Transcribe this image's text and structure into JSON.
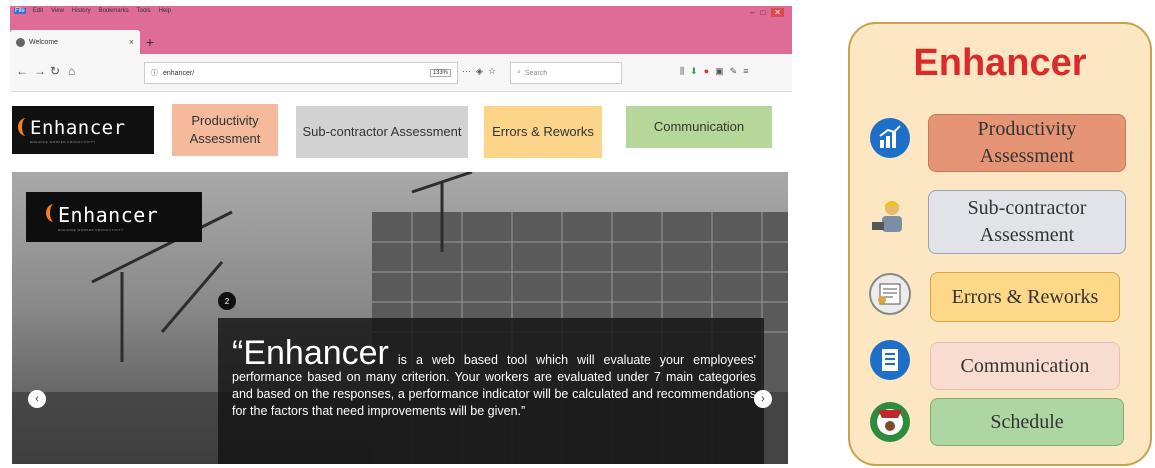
{
  "browser": {
    "menu": [
      "File",
      "Edit",
      "View",
      "History",
      "Bookmarks",
      "Tools",
      "Help"
    ],
    "window_controls": [
      "–",
      "□",
      "✕"
    ],
    "tab_title": "Welcome",
    "tab_close": "×",
    "new_tab": "+",
    "url": "enhancer/",
    "zoom": "133%",
    "search_placeholder": "Search"
  },
  "site": {
    "logo_text": "Enhancer",
    "logo_tagline": "ENHANCE WORKER PRODUCTIVITY",
    "nav": {
      "productivity": "Productivity Assessment",
      "subcontractor": "Sub-contractor Assessment",
      "errors": "Errors & Reworks",
      "communication": "Communication"
    },
    "hero": {
      "logo_text": "Enhancer",
      "logo_tagline": "ENHANCE WORKER PRODUCTIVITY",
      "slide_number": "2",
      "caption_lead": "“Enhancer",
      "caption_body": " is a web based tool which will evaluate your employees' performance based on many criterion. Your workers are evaluated under 7 main categories and based on the responses, a performance indicator will be calculated and recommendations for the factors that need improvements will be given.”",
      "prev": "‹",
      "next": "›"
    }
  },
  "panel": {
    "title": "Enhancer",
    "items": {
      "productivity": "Productivity Assessment",
      "subcontractor": "Sub-contractor Assessment",
      "errors": "Errors & Reworks",
      "communication": "Communication",
      "schedule": "Schedule"
    }
  },
  "colors": {
    "titlebar": "#df6b97",
    "panel_title": "#d92b2b",
    "panel_bg": "#fde7c2"
  }
}
